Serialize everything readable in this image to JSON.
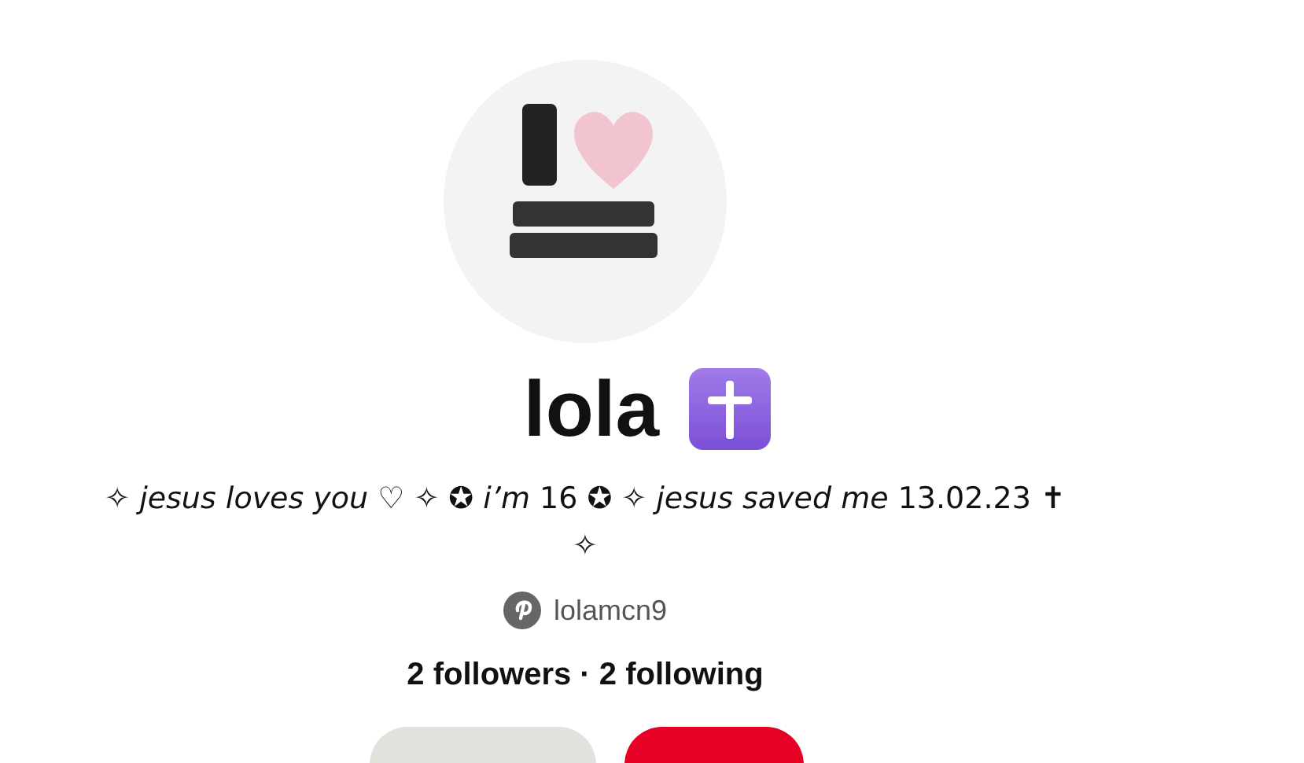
{
  "profile": {
    "name": "lola",
    "bio": "✧ *jesus loves you* ♡ ✧ ✪ *i’m* 16 ✪ ✧ *jesus saved me* 13.02.23 ✝ ✧",
    "username": "lolamcn9",
    "stats": "2 followers · 2 following",
    "buttons": [
      {
        "kind": "secondary"
      },
      {
        "kind": "primary"
      }
    ]
  }
}
